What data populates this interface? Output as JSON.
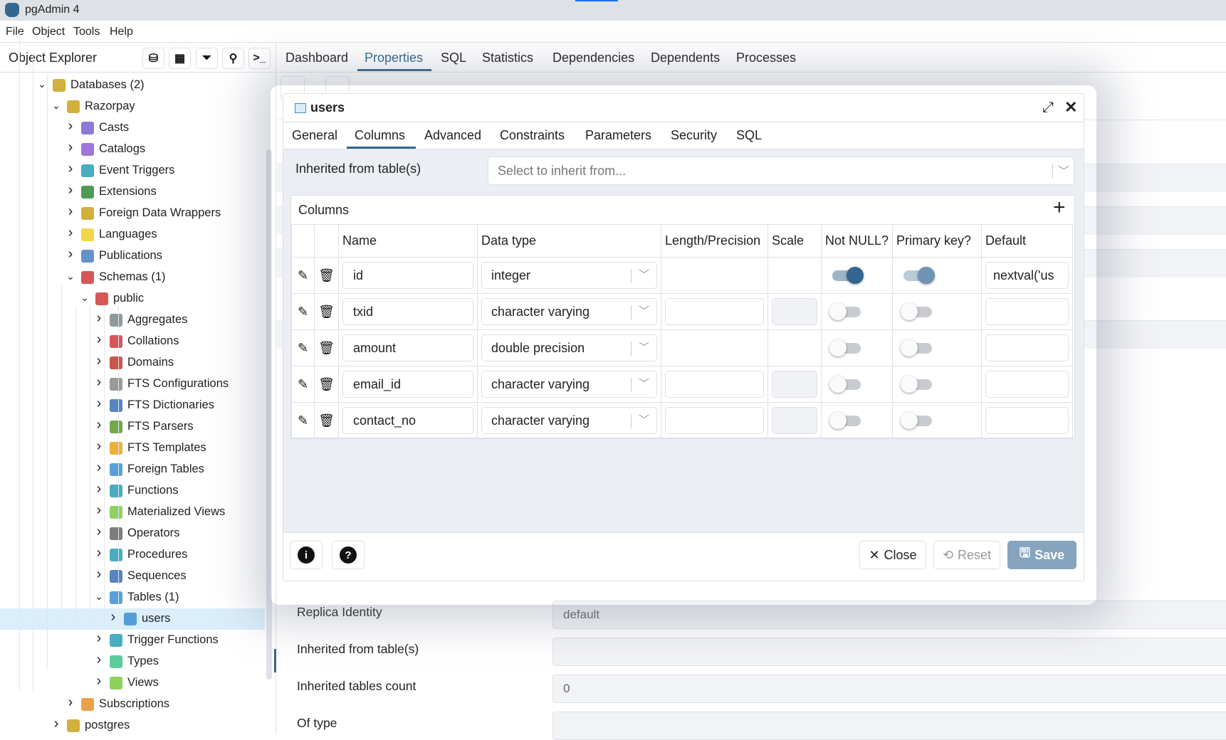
{
  "app": {
    "title": "pgAdmin 4"
  },
  "menu": [
    "File",
    "Object",
    "Tools",
    "Help"
  ],
  "explorer": {
    "title": "Object Explorer",
    "toolbar": [
      "query-tool-icon",
      "view-data-icon",
      "filtered-rows-icon",
      "search-objects-icon",
      "psql-tool-icon"
    ],
    "tree": [
      {
        "label": "Databases (2)",
        "depth": 0,
        "state": "expanded",
        "icon": "databases-icon",
        "color": "#c9a21c"
      },
      {
        "label": "Razorpay",
        "depth": 1,
        "state": "expanded",
        "icon": "database-icon",
        "color": "#c9a21c"
      },
      {
        "label": "Casts",
        "depth": 2,
        "state": "collapsed",
        "icon": "casts-icon",
        "color": "#7b5fcf"
      },
      {
        "label": "Catalogs",
        "depth": 2,
        "state": "collapsed",
        "icon": "catalogs-icon",
        "color": "#8e5ed6"
      },
      {
        "label": "Event Triggers",
        "depth": 2,
        "state": "collapsed",
        "icon": "event-triggers-icon",
        "color": "#2a9fb5"
      },
      {
        "label": "Extensions",
        "depth": 2,
        "state": "collapsed",
        "icon": "extensions-icon",
        "color": "#2f8a3a"
      },
      {
        "label": "Foreign Data Wrappers",
        "depth": 2,
        "state": "collapsed",
        "icon": "foreign-data-wrappers-icon",
        "color": "#c9a21c"
      },
      {
        "label": "Languages",
        "depth": 2,
        "state": "collapsed",
        "icon": "languages-icon",
        "color": "#f0cf2a"
      },
      {
        "label": "Publications",
        "depth": 2,
        "state": "collapsed",
        "icon": "publications-icon",
        "color": "#4a7fc1"
      },
      {
        "label": "Schemas (1)",
        "depth": 2,
        "state": "expanded",
        "icon": "schemas-icon",
        "color": "#d0393b"
      },
      {
        "label": "public",
        "depth": 3,
        "state": "expanded",
        "icon": "schema-icon",
        "color": "#d0393b"
      },
      {
        "label": "Aggregates",
        "depth": 4,
        "state": "collapsed",
        "icon": "aggregates-icon",
        "color": "#7a8a8a"
      },
      {
        "label": "Collations",
        "depth": 4,
        "state": "collapsed",
        "icon": "collations-icon",
        "color": "#d0393b"
      },
      {
        "label": "Domains",
        "depth": 4,
        "state": "collapsed",
        "icon": "domains-icon",
        "color": "#c0392b"
      },
      {
        "label": "FTS Configurations",
        "depth": 4,
        "state": "collapsed",
        "icon": "fts-configurations-icon",
        "color": "#888888"
      },
      {
        "label": "FTS Dictionaries",
        "depth": 4,
        "state": "collapsed",
        "icon": "fts-dictionaries-icon",
        "color": "#3b6fb5"
      },
      {
        "label": "FTS Parsers",
        "depth": 4,
        "state": "collapsed",
        "icon": "fts-parsers-icon",
        "color": "#5a9a2a"
      },
      {
        "label": "FTS Templates",
        "depth": 4,
        "state": "collapsed",
        "icon": "fts-templates-icon",
        "color": "#e8a317"
      },
      {
        "label": "Foreign Tables",
        "depth": 4,
        "state": "collapsed",
        "icon": "foreign-tables-icon",
        "color": "#3b8fd0"
      },
      {
        "label": "Functions",
        "depth": 4,
        "state": "collapsed",
        "icon": "functions-icon",
        "color": "#2a9fb5"
      },
      {
        "label": "Materialized Views",
        "depth": 4,
        "state": "collapsed",
        "icon": "materialized-views-icon",
        "color": "#7ac943"
      },
      {
        "label": "Operators",
        "depth": 4,
        "state": "collapsed",
        "icon": "operators-icon",
        "color": "#666666"
      },
      {
        "label": "Procedures",
        "depth": 4,
        "state": "collapsed",
        "icon": "procedures-icon",
        "color": "#2a9fb5"
      },
      {
        "label": "Sequences",
        "depth": 4,
        "state": "collapsed",
        "icon": "sequences-icon",
        "color": "#3b6fb5"
      },
      {
        "label": "Tables (1)",
        "depth": 4,
        "state": "expanded",
        "icon": "tables-icon",
        "color": "#3b8fd0"
      },
      {
        "label": "users",
        "depth": 5,
        "state": "collapsed",
        "icon": "table-icon",
        "color": "#3b8fd0",
        "selected": true
      },
      {
        "label": "Trigger Functions",
        "depth": 4,
        "state": "collapsed",
        "icon": "trigger-functions-icon",
        "color": "#2a9fb5"
      },
      {
        "label": "Types",
        "depth": 4,
        "state": "collapsed",
        "icon": "types-icon",
        "color": "#3fc48a"
      },
      {
        "label": "Views",
        "depth": 4,
        "state": "collapsed",
        "icon": "views-icon",
        "color": "#7ac943"
      },
      {
        "label": "Subscriptions",
        "depth": 2,
        "state": "collapsed",
        "icon": "subscriptions-icon",
        "color": "#e8902a"
      },
      {
        "label": "postgres",
        "depth": 1,
        "state": "collapsed",
        "icon": "database-icon",
        "color": "#c9a21c"
      }
    ]
  },
  "main_tabs": {
    "items": [
      "Dashboard",
      "Properties",
      "SQL",
      "Statistics",
      "Dependencies",
      "Dependents",
      "Processes"
    ],
    "active": "Properties"
  },
  "background_props": [
    {
      "label": "Replica Identity",
      "value": "default"
    },
    {
      "label": "Inherited from table(s)",
      "value": ""
    },
    {
      "label": "Inherited tables count",
      "value": "0"
    },
    {
      "label": "Of type",
      "value": ""
    }
  ],
  "dialog": {
    "title": "users",
    "tabs": [
      "General",
      "Columns",
      "Advanced",
      "Constraints",
      "Parameters",
      "Security",
      "SQL"
    ],
    "active_tab": "Columns",
    "inherit_label": "Inherited from table(s)",
    "inherit_placeholder": "Select to inherit from...",
    "columns_title": "Columns",
    "headers": [
      "",
      "",
      "Name",
      "Data type",
      "Length/Precision",
      "Scale",
      "Not NULL?",
      "Primary key?",
      "Default"
    ],
    "rows": [
      {
        "name": "id",
        "data_type": "integer",
        "length": null,
        "scale": null,
        "not_null": true,
        "primary_key": true,
        "default": "nextval('users_id_seq'::regclass)",
        "default_visible": "nextval('us"
      },
      {
        "name": "txid",
        "data_type": "character varying",
        "length": "",
        "scale": "",
        "not_null": false,
        "primary_key": false,
        "default": ""
      },
      {
        "name": "amount",
        "data_type": "double precision",
        "length": null,
        "scale": null,
        "not_null": false,
        "primary_key": false,
        "default": ""
      },
      {
        "name": "email_id",
        "data_type": "character varying",
        "length": "",
        "scale": "",
        "not_null": false,
        "primary_key": false,
        "default": ""
      },
      {
        "name": "contact_no",
        "data_type": "character varying",
        "length": "",
        "scale": "",
        "not_null": false,
        "primary_key": false,
        "default": ""
      }
    ],
    "footer": {
      "close": "Close",
      "reset": "Reset",
      "save": "Save"
    },
    "colors": {
      "accent": "#326690",
      "save_bg": "#86a4bd"
    }
  }
}
